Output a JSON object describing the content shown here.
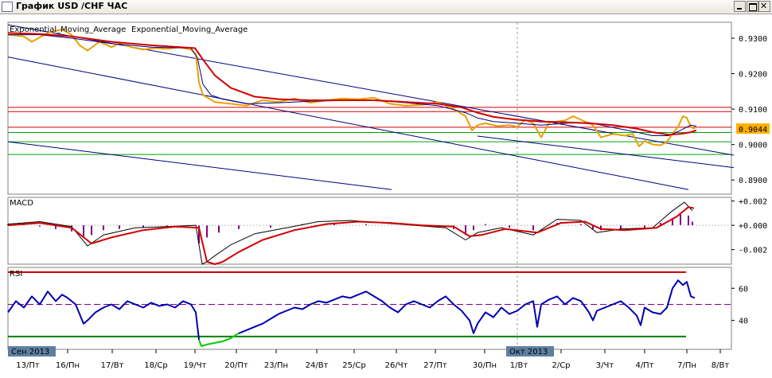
{
  "window": {
    "title": "График USD /CHF ЧАС"
  },
  "colors": {
    "price": "#e8a000",
    "ema_fast": "#000080",
    "ema_slow": "#d00000",
    "channel": "#000080",
    "red_level": "#d00000",
    "green_level": "#00a000",
    "macd_hist": "#800080",
    "rsi_line": "#0000b0",
    "rsi_oversold": "#00cc00",
    "rsi_upper": "#d00000",
    "rsi_lower": "#008000",
    "rsi_mid": "#800080",
    "current_price_bg": "#ffb000"
  },
  "chart_data": [
    {
      "panel": "price",
      "type": "line",
      "legend": [
        "Exponential_Moving_Average",
        "Exponential_Moving_Average"
      ],
      "ylim": [
        0.886,
        0.9345
      ],
      "y_ticks": [
        "0.9300",
        "0.9200",
        "0.9100",
        "0.9000",
        "0.8900"
      ],
      "y_tick_values": [
        0.93,
        0.92,
        0.91,
        0.9,
        0.89
      ],
      "current_price": "0.9044",
      "current_price_value": 0.9044,
      "horizontal_levels": [
        {
          "value": 0.9105,
          "color": "red"
        },
        {
          "value": 0.9093,
          "color": "red"
        },
        {
          "value": 0.9049,
          "color": "red"
        },
        {
          "value": 0.9034,
          "color": "green"
        },
        {
          "value": 0.9008,
          "color": "green"
        },
        {
          "value": 0.8972,
          "color": "green"
        }
      ],
      "channel_lines": [
        {
          "x": [
            0,
            912
          ],
          "y": [
            0.9338,
            0.897
          ]
        },
        {
          "x": [
            0,
            855
          ],
          "y": [
            0.9247,
            0.8873
          ]
        },
        {
          "x": [
            0,
            482
          ],
          "y": [
            0.9008,
            0.8873
          ]
        },
        {
          "x": [
            590,
            912
          ],
          "y": [
            0.9024,
            0.8935
          ]
        }
      ],
      "series": [
        {
          "name": "Price",
          "x": [
            0,
            20,
            30,
            50,
            68,
            80,
            90,
            100,
            115,
            130,
            140,
            155,
            170,
            185,
            200,
            215,
            230,
            236,
            240,
            245,
            260,
            280,
            300,
            320,
            340,
            360,
            380,
            400,
            420,
            440,
            460,
            480,
            500,
            520,
            540,
            560,
            575,
            583,
            590,
            600,
            615,
            630,
            640,
            650,
            660,
            670,
            680,
            700,
            710,
            720,
            735,
            745,
            760,
            775,
            785,
            793,
            800,
            810,
            820,
            828,
            835,
            842,
            848,
            853,
            858,
            863
          ],
          "values": [
            0.931,
            0.9305,
            0.929,
            0.9315,
            0.9325,
            0.931,
            0.928,
            0.9265,
            0.929,
            0.9275,
            0.9285,
            0.9275,
            0.9268,
            0.9272,
            0.927,
            0.9275,
            0.9268,
            0.9255,
            0.9175,
            0.914,
            0.912,
            0.9115,
            0.911,
            0.9125,
            0.912,
            0.913,
            0.9118,
            0.9125,
            0.913,
            0.9128,
            0.9132,
            0.9115,
            0.911,
            0.9112,
            0.912,
            0.91,
            0.908,
            0.904,
            0.9055,
            0.906,
            0.9052,
            0.9055,
            0.905,
            0.907,
            0.906,
            0.902,
            0.9062,
            0.9068,
            0.908,
            0.907,
            0.9055,
            0.902,
            0.903,
            0.9025,
            0.903,
            0.8995,
            0.901,
            0.9,
            0.8998,
            0.9008,
            0.903,
            0.905,
            0.908,
            0.9075,
            0.905,
            0.9044
          ]
        },
        {
          "name": "Exponential_Moving_Average",
          "x": [
            0,
            40,
            80,
            130,
            180,
            230,
            238,
            245,
            255,
            270,
            300,
            340,
            380,
            420,
            460,
            500,
            540,
            575,
            590,
            610,
            640,
            670,
            700,
            730,
            760,
            790,
            810,
            830,
            845,
            858,
            865
          ],
          "values": [
            0.931,
            0.931,
            0.93,
            0.9285,
            0.9275,
            0.9272,
            0.9245,
            0.917,
            0.914,
            0.9128,
            0.9115,
            0.9118,
            0.9122,
            0.9124,
            0.9125,
            0.9118,
            0.911,
            0.909,
            0.9075,
            0.9065,
            0.906,
            0.9055,
            0.906,
            0.9062,
            0.9048,
            0.9035,
            0.9025,
            0.9025,
            0.904,
            0.9055,
            0.9052
          ]
        },
        {
          "name": "Exponential_Moving_Average",
          "x": [
            0,
            40,
            80,
            130,
            180,
            235,
            245,
            260,
            280,
            310,
            340,
            380,
            420,
            460,
            500,
            540,
            570,
            590,
            610,
            640,
            670,
            700,
            730,
            760,
            790,
            810,
            830,
            845,
            858,
            865
          ],
          "values": [
            0.9315,
            0.9312,
            0.9305,
            0.929,
            0.928,
            0.9272,
            0.924,
            0.9195,
            0.916,
            0.9135,
            0.9128,
            0.9125,
            0.9125,
            0.9125,
            0.912,
            0.9115,
            0.9105,
            0.909,
            0.9078,
            0.907,
            0.9065,
            0.9063,
            0.906,
            0.9055,
            0.9045,
            0.9035,
            0.9028,
            0.903,
            0.9035,
            0.904
          ]
        }
      ]
    },
    {
      "panel": "macd",
      "type": "line",
      "label": "MACD",
      "ylim": [
        -0.0032,
        0.0023
      ],
      "y_ticks": [
        "+0.002",
        "+0.000",
        "-0.002"
      ],
      "y_tick_values": [
        0.002,
        0.0,
        -0.002
      ],
      "histogram": {
        "x": [
          0,
          20,
          40,
          60,
          80,
          95,
          105,
          120,
          140,
          170,
          200,
          230,
          240,
          250,
          265,
          290,
          330,
          370,
          410,
          450,
          490,
          530,
          560,
          575,
          585,
          600,
          630,
          660,
          690,
          720,
          735,
          745,
          770,
          800,
          820,
          835,
          845,
          855,
          860
        ],
        "values": [
          0.0001,
          0.0002,
          -0.0001,
          -0.0003,
          -0.0005,
          -0.0009,
          -0.0008,
          -0.0004,
          -0.0003,
          -0.0002,
          -0.0001,
          0.0,
          -0.0015,
          -0.001,
          -0.0006,
          -0.0003,
          -0.0002,
          0.0001,
          0.0002,
          0.0001,
          0.0,
          -0.0001,
          -0.0003,
          -0.0008,
          -0.0004,
          0.0001,
          -0.0002,
          -0.0004,
          0.0002,
          0.0001,
          -0.0003,
          -0.0004,
          -0.0003,
          -0.0002,
          0.0002,
          0.0006,
          0.0009,
          0.0008,
          0.0003
        ]
      },
      "series": [
        {
          "name": "MACD",
          "x": [
            0,
            40,
            80,
            100,
            120,
            160,
            200,
            236,
            244,
            250,
            260,
            280,
            310,
            350,
            390,
            430,
            470,
            510,
            550,
            575,
            590,
            620,
            660,
            690,
            720,
            740,
            770,
            810,
            835,
            850,
            860
          ],
          "values": [
            0.0001,
            0.0003,
            -0.0001,
            -0.0017,
            -0.0008,
            -0.0002,
            -0.0001,
            0.0,
            -0.0032,
            -0.003,
            -0.0025,
            -0.0016,
            -0.0007,
            -0.0002,
            0.0003,
            0.0004,
            0.0002,
            0.0,
            -0.0002,
            -0.0012,
            -0.0006,
            -0.0002,
            -0.0008,
            0.0005,
            0.0004,
            -0.0006,
            -0.0003,
            -0.0002,
            0.0012,
            0.0019,
            0.0012
          ]
        },
        {
          "name": "Signal",
          "x": [
            0,
            40,
            80,
            105,
            130,
            170,
            210,
            240,
            250,
            260,
            270,
            290,
            320,
            360,
            400,
            440,
            480,
            520,
            560,
            580,
            595,
            625,
            665,
            695,
            725,
            745,
            775,
            815,
            840,
            855,
            862
          ],
          "values": [
            0.0,
            0.0002,
            -0.0002,
            -0.0015,
            -0.001,
            -0.0004,
            -0.0001,
            -0.0002,
            -0.003,
            -0.0032,
            -0.003,
            -0.0022,
            -0.0012,
            -0.0004,
            0.0001,
            0.0003,
            0.0002,
            0.0,
            -0.0001,
            -0.0009,
            -0.0008,
            -0.0003,
            -0.0006,
            0.0002,
            0.0003,
            -0.0003,
            -0.0004,
            -0.0002,
            0.0007,
            0.0015,
            0.0014
          ]
        }
      ]
    },
    {
      "panel": "rsi",
      "type": "line",
      "label": "RSI",
      "ylim": [
        22,
        73
      ],
      "y_ticks": [
        "60",
        "40"
      ],
      "y_tick_values": [
        60,
        40
      ],
      "levels": {
        "upper": 70,
        "mid": 50,
        "lower": 30
      },
      "series": [
        {
          "name": "RSI",
          "x": [
            0,
            10,
            20,
            30,
            40,
            50,
            60,
            68,
            75,
            85,
            95,
            100,
            110,
            120,
            130,
            140,
            150,
            160,
            170,
            180,
            190,
            200,
            210,
            220,
            230,
            236,
            240,
            243,
            250,
            260,
            270,
            280,
            290,
            300,
            310,
            320,
            330,
            340,
            350,
            360,
            370,
            380,
            390,
            400,
            410,
            420,
            430,
            440,
            450,
            460,
            470,
            480,
            490,
            500,
            510,
            520,
            530,
            540,
            550,
            560,
            570,
            580,
            585,
            590,
            600,
            610,
            620,
            630,
            640,
            650,
            660,
            665,
            670,
            680,
            690,
            700,
            710,
            720,
            730,
            735,
            740,
            750,
            760,
            770,
            780,
            790,
            795,
            800,
            810,
            820,
            828,
            835,
            842,
            848,
            853,
            858,
            863
          ],
          "values": [
            45,
            52,
            48,
            55,
            50,
            58,
            52,
            56,
            54,
            50,
            38,
            40,
            45,
            48,
            50,
            47,
            52,
            50,
            48,
            51,
            49,
            50,
            48,
            52,
            50,
            45,
            28,
            24,
            25,
            26,
            27,
            29,
            32,
            34,
            36,
            38,
            41,
            44,
            46,
            48,
            47,
            50,
            52,
            51,
            53,
            55,
            54,
            56,
            58,
            55,
            52,
            48,
            45,
            50,
            52,
            50,
            48,
            52,
            55,
            50,
            46,
            40,
            32,
            38,
            45,
            42,
            48,
            44,
            46,
            50,
            52,
            36,
            50,
            53,
            55,
            50,
            54,
            52,
            45,
            40,
            46,
            48,
            50,
            52,
            48,
            43,
            37,
            48,
            45,
            44,
            48,
            60,
            65,
            62,
            64,
            55,
            54
          ]
        }
      ]
    }
  ],
  "x_axis": {
    "labels": [
      "13/Пт",
      "16/Пн",
      "17/Вт",
      "18/Ср",
      "19/Чт",
      "20/Пт",
      "23/Пн",
      "24/Вт",
      "25/Ср",
      "26/Чт",
      "27/Пт",
      "30/Пн",
      "1/Вт",
      "2/Ср",
      "3/Чт",
      "4/Пт",
      "7/Пн",
      "8/Вт"
    ],
    "positions": [
      35,
      85,
      141,
      196,
      245,
      297,
      347,
      398,
      445,
      498,
      547,
      609,
      652,
      705,
      760,
      810,
      863,
      905
    ],
    "month_labels": [
      "Сен 2013",
      "Окт 2013"
    ],
    "month_positions": [
      10,
      636
    ]
  }
}
